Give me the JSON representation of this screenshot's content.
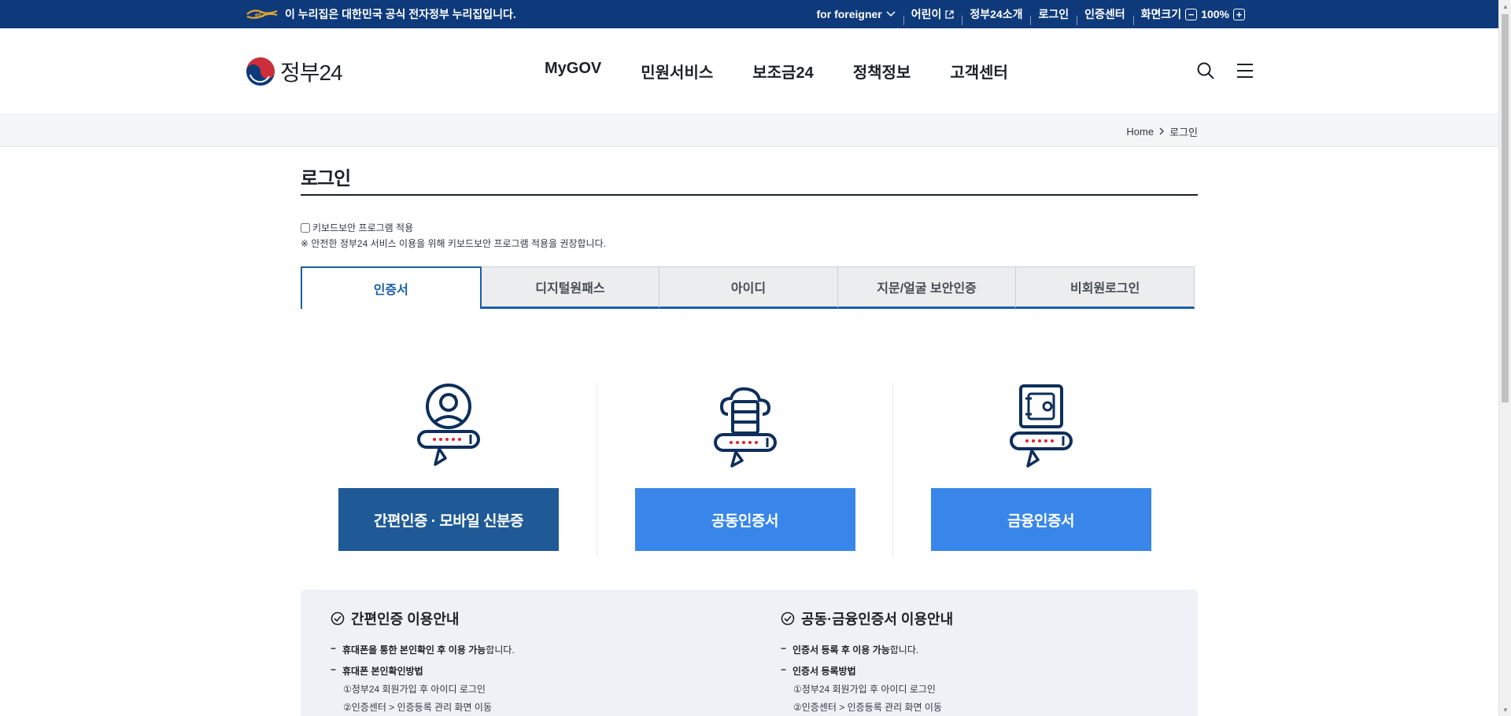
{
  "govbar": {
    "notice": "이 누리집은 대한민국 공식 전자정부 누리집입니다.",
    "foreigner": "for foreigner",
    "kids": "어린이",
    "about": "정부24소개",
    "login": "로그인",
    "cert_center": "인증센터",
    "screen_size": "화면크기",
    "zoom": "100%"
  },
  "header": {
    "logo_text": "정부24",
    "nav": [
      "MyGOV",
      "민원서비스",
      "보조금24",
      "정책정보",
      "고객센터"
    ]
  },
  "breadcrumb": {
    "home": "Home",
    "current": "로그인"
  },
  "page": {
    "title": "로그인",
    "keyboard_label": "키보드보안 프로그램 적용",
    "keyboard_note": "※ 안전한 정부24 서비스 이용을 위해 키보드보안 프로그램 적용을 권장합니다."
  },
  "tabs": [
    "인증서",
    "디지털원패스",
    "아이디",
    "지문/얼굴 보안인증",
    "비회원로그인"
  ],
  "cards": [
    {
      "label": "간편인증 · 모바일 신분증"
    },
    {
      "label": "공동인증서"
    },
    {
      "label": "금융인증서"
    }
  ],
  "guide": {
    "left": {
      "title": "간편인증 이용안내",
      "line1_bold": "휴대폰을 통한 본인확인 후 이용 가능",
      "line1_rest": "합니다.",
      "line2": "휴대폰 본인확인방법",
      "step1": "①정부24 회원가입 후 아이디 로그인",
      "step2": "②인증센터 > 인증등록 관리 화면 이동"
    },
    "right": {
      "title": "공동·금융인증서 이용안내",
      "line1_bold": "인증서 등록 후 이용 가능",
      "line1_rest": "합니다.",
      "line2": "인증서 등록방법",
      "step1": "①정부24 회원가입 후 아이디 로그인",
      "step2": "②인증센터 > 인증등록 관리 화면 이동"
    }
  },
  "colors": {
    "govbar_bg": "#0e3a7b",
    "tab_active": "#1a5fa8",
    "btn_dark": "#1f5a96",
    "btn_light": "#3886ea",
    "icon_navy": "#0e2f5a",
    "icon_red": "#e2232b"
  }
}
